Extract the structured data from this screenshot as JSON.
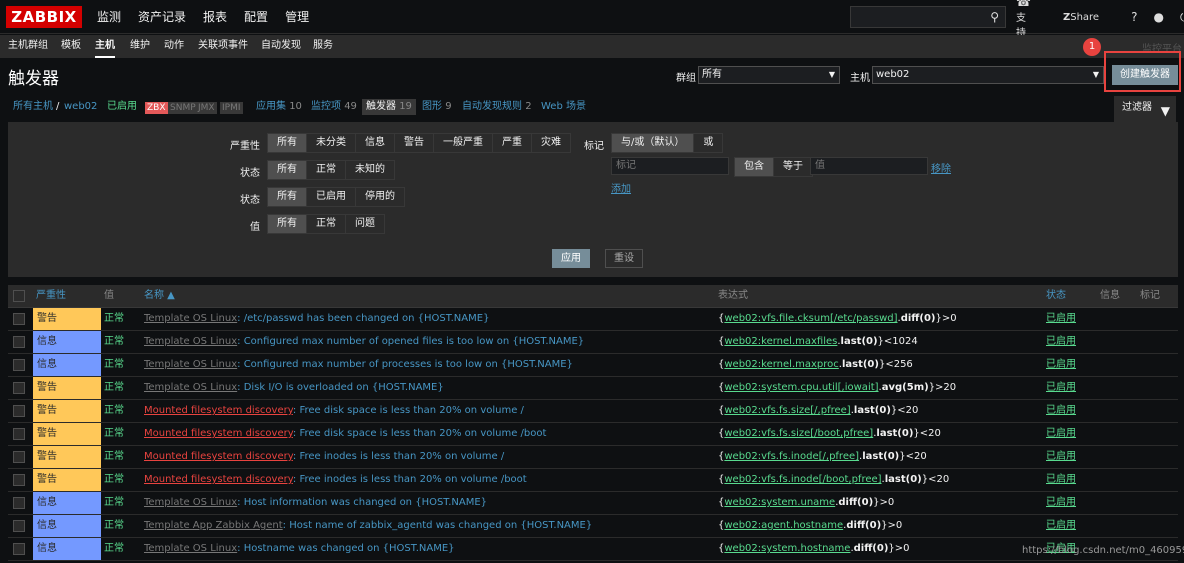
{
  "app": {
    "logo": "ZABBIX"
  },
  "top_menu": [
    "监测",
    "资产记录",
    "报表",
    "配置",
    "管理"
  ],
  "top_links": {
    "support": "支持",
    "share": "Share",
    "help": "?",
    "user": "user-icon",
    "logout": "power-icon"
  },
  "sub_menu": [
    "主机群组",
    "模板",
    "主机",
    "维护",
    "动作",
    "关联项事件",
    "自动发现",
    "服务"
  ],
  "sub_menu_active": "主机",
  "monitor_link": "监控平台",
  "annotation_badge": "1",
  "page": {
    "title": "触发器",
    "group_label": "群组",
    "group_value": "所有",
    "host_label": "主机",
    "host_value": "web02",
    "create_button": "创建触发器"
  },
  "nav": {
    "all_hosts": "所有主机",
    "sep": "/",
    "host": "web02",
    "enabled": "已启用",
    "tags": [
      "ZBX",
      "SNMP",
      "JMX",
      "IPMI"
    ],
    "apps": "应用集",
    "apps_count": "10",
    "items": "监控项",
    "items_count": "49",
    "triggers": "触发器",
    "triggers_count": "19",
    "graphs": "图形",
    "graphs_count": "9",
    "discovery": "自动发现规则",
    "discovery_count": "2",
    "web": "Web 场景"
  },
  "filter": {
    "tab_label": "过滤器",
    "severity_label": "严重性",
    "severity_options": [
      "所有",
      "未分类",
      "信息",
      "警告",
      "一般严重",
      "严重",
      "灾难"
    ],
    "state_label": "状态",
    "state_options": [
      "所有",
      "正常",
      "未知的"
    ],
    "status_label": "状态",
    "status_options": [
      "所有",
      "已启用",
      "停用的"
    ],
    "value_label": "值",
    "value_options": [
      "所有",
      "正常",
      "问题"
    ],
    "tags_label": "标记",
    "tags_mode": [
      "与/或（默认）",
      "或"
    ],
    "tag_placeholder": "标记",
    "tag_op": [
      "包含",
      "等于"
    ],
    "value_placeholder": "值",
    "remove": "移除",
    "add": "添加",
    "apply": "应用",
    "reset": "重设"
  },
  "table": {
    "headers": {
      "severity": "严重性",
      "value": "值",
      "name": "名称 ▲",
      "expression": "表达式",
      "status": "状态",
      "info": "信息",
      "tags": "标记"
    },
    "rows": [
      {
        "sev": "警告",
        "sev_type": "warn",
        "val": "正常",
        "prefix": "Template OS Linux",
        "prefix_type": "tpl",
        "text": ": /etc/passwd has been changed on {HOST.NAME}",
        "ek": "web02:vfs.file.cksum[/etc/passwd]",
        "ef": "diff(0)",
        "et": "}>0",
        "status": "已启用"
      },
      {
        "sev": "信息",
        "sev_type": "info",
        "val": "正常",
        "prefix": "Template OS Linux",
        "prefix_type": "tpl",
        "text": ": Configured max number of opened files is too low on {HOST.NAME}",
        "ek": "web02:kernel.maxfiles",
        "ef": "last(0)",
        "et": "}<1024",
        "status": "已启用"
      },
      {
        "sev": "信息",
        "sev_type": "info",
        "val": "正常",
        "prefix": "Template OS Linux",
        "prefix_type": "tpl",
        "text": ": Configured max number of processes is too low on {HOST.NAME}",
        "ek": "web02:kernel.maxproc",
        "ef": "last(0)",
        "et": "}<256",
        "status": "已启用"
      },
      {
        "sev": "警告",
        "sev_type": "warn",
        "val": "正常",
        "prefix": "Template OS Linux",
        "prefix_type": "tpl",
        "text": ": Disk I/O is overloaded on {HOST.NAME}",
        "ek": "web02:system.cpu.util[,iowait]",
        "ef": "avg(5m)",
        "et": "}>20",
        "status": "已启用"
      },
      {
        "sev": "警告",
        "sev_type": "warn",
        "val": "正常",
        "prefix": "Mounted filesystem discovery",
        "prefix_type": "disc",
        "text": ": Free disk space is less than 20% on volume /",
        "ek": "web02:vfs.fs.size[/,pfree]",
        "ef": "last(0)",
        "et": "}<20",
        "status": "已启用"
      },
      {
        "sev": "警告",
        "sev_type": "warn",
        "val": "正常",
        "prefix": "Mounted filesystem discovery",
        "prefix_type": "disc",
        "text": ": Free disk space is less than 20% on volume /boot",
        "ek": "web02:vfs.fs.size[/boot,pfree]",
        "ef": "last(0)",
        "et": "}<20",
        "status": "已启用"
      },
      {
        "sev": "警告",
        "sev_type": "warn",
        "val": "正常",
        "prefix": "Mounted filesystem discovery",
        "prefix_type": "disc",
        "text": ": Free inodes is less than 20% on volume /",
        "ek": "web02:vfs.fs.inode[/,pfree]",
        "ef": "last(0)",
        "et": "}<20",
        "status": "已启用"
      },
      {
        "sev": "警告",
        "sev_type": "warn",
        "val": "正常",
        "prefix": "Mounted filesystem discovery",
        "prefix_type": "disc",
        "text": ": Free inodes is less than 20% on volume /boot",
        "ek": "web02:vfs.fs.inode[/boot,pfree]",
        "ef": "last(0)",
        "et": "}<20",
        "status": "已启用"
      },
      {
        "sev": "信息",
        "sev_type": "info",
        "val": "正常",
        "prefix": "Template OS Linux",
        "prefix_type": "tpl",
        "text": ": Host information was changed on {HOST.NAME}",
        "ek": "web02:system.uname",
        "ef": "diff(0)",
        "et": "}>0",
        "status": "已启用"
      },
      {
        "sev": "信息",
        "sev_type": "info",
        "val": "正常",
        "prefix": "Template App Zabbix Agent",
        "prefix_type": "tpl",
        "text": ": Host name of zabbix_agentd was changed on {HOST.NAME}",
        "ek": "web02:agent.hostname",
        "ef": "diff(0)",
        "et": "}>0",
        "status": "已启用"
      },
      {
        "sev": "信息",
        "sev_type": "info",
        "val": "正常",
        "prefix": "Template OS Linux",
        "prefix_type": "tpl",
        "text": ": Hostname was changed on {HOST.NAME}",
        "ek": "web02:system.hostname",
        "ef": "diff(0)",
        "et": "}>0",
        "status": "已启用"
      }
    ]
  },
  "watermark": "https://blog.csdn.net/m0_46095955"
}
